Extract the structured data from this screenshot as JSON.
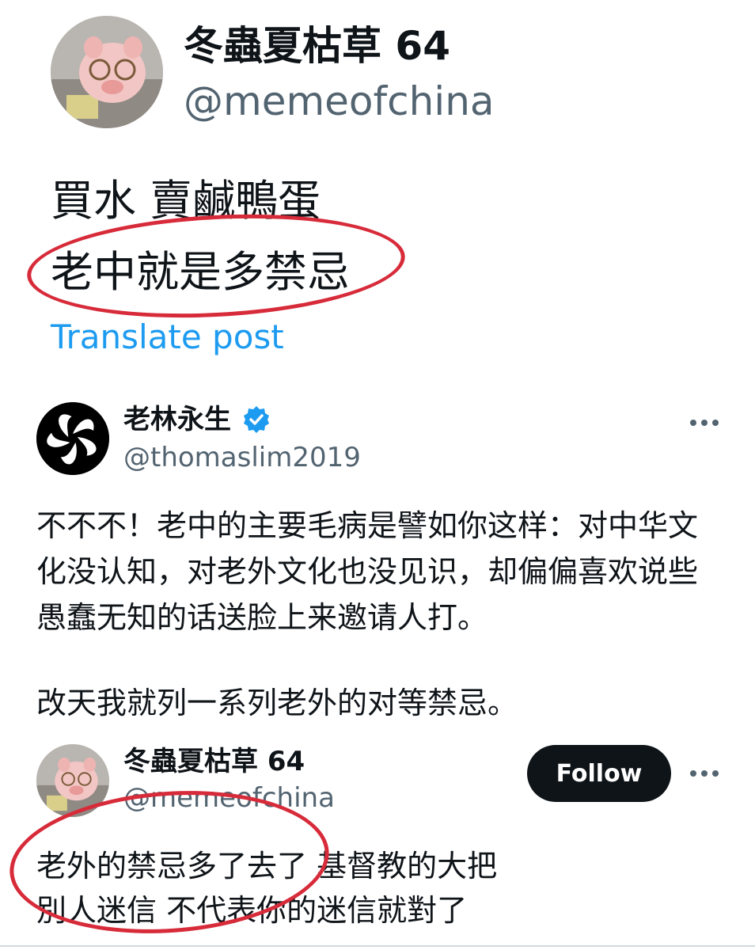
{
  "top_post": {
    "author_name": "冬蟲夏枯草 64",
    "handle": "@memeofchina",
    "line1": "買水 賣鹹鴨蛋",
    "line2": "老中就是多禁忌",
    "translate_label": "Translate post"
  },
  "reply_post": {
    "author_name": "老林永生",
    "verified": true,
    "handle": "@thomaslim2019",
    "more_icon": "more-horizontal-icon",
    "lines": [
      "不不不！老中的主要毛病是譬如你这样：对中华文",
      "化没认知，对老外文化也没见识，却偏偏喜欢说些",
      "愚蠢无知的话送脸上来邀请人打。",
      "改天我就列一系列老外的对等禁忌。"
    ]
  },
  "bottom_post": {
    "author_name": "冬蟲夏枯草 64",
    "handle": "@memeofchina",
    "follow_label": "Follow",
    "more_icon": "more-horizontal-icon",
    "lines": [
      "老外的禁忌多了去了 基督教的大把",
      "別人迷信 不代表你的迷信就對了"
    ]
  },
  "colors": {
    "verified_badge": "#1d9bf0",
    "annotation_circle": "#d72b3a",
    "link": "#1d9bf0"
  }
}
